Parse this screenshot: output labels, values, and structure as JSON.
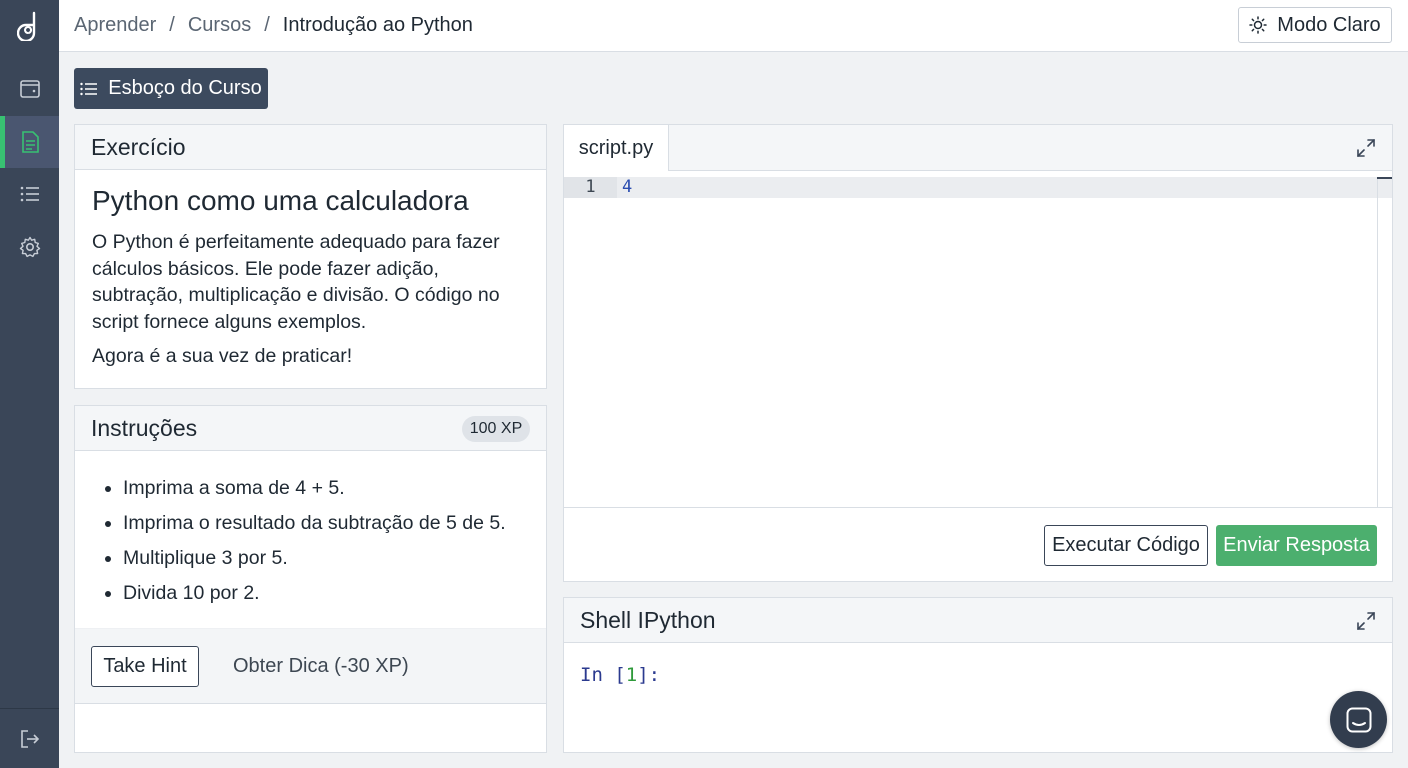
{
  "breadcrumb": {
    "items": [
      "Aprender",
      "Cursos"
    ],
    "separator": "/",
    "current": "Introdução ao Python"
  },
  "header": {
    "mode_label": "Modo Claro"
  },
  "toolbar": {
    "outline_label": "Esboço do Curso"
  },
  "exercise": {
    "header": "Exercício",
    "title": "Python como uma calculadora",
    "body": "O Python é perfeitamente adequado para fazer cálculos básicos. Ele pode fazer adição, subtração, multiplicação e divisão. O código no script fornece alguns exemplos.",
    "body2": "Agora é a sua vez de praticar!"
  },
  "instructions": {
    "header": "Instruções",
    "xp": "100 XP",
    "items": [
      "Imprima a soma de 4 + 5.",
      "Imprima o resultado da subtração de 5 de 5.",
      "Multiplique 3 por 5.",
      "Divida 10 por 2."
    ],
    "hint_button": "Take Hint",
    "hint_text": "Obter Dica (-30 XP)"
  },
  "editor": {
    "tab": "script.py",
    "line_number": "1",
    "code": "4",
    "run_label": "Executar Código",
    "submit_label": "Enviar Resposta"
  },
  "shell": {
    "header": "Shell IPython",
    "prompt_prefix": "In [",
    "prompt_number": "1",
    "prompt_suffix": "]:"
  },
  "colors": {
    "sidebar": "#3a4658",
    "accent_green": "#38c172",
    "submit": "#4caf6e"
  },
  "icons": [
    "logo-icon",
    "browser-icon",
    "document-icon",
    "list-icon",
    "gear-icon",
    "logout-icon",
    "sun-icon",
    "menu-list-icon",
    "expand-icon",
    "chat-icon"
  ]
}
